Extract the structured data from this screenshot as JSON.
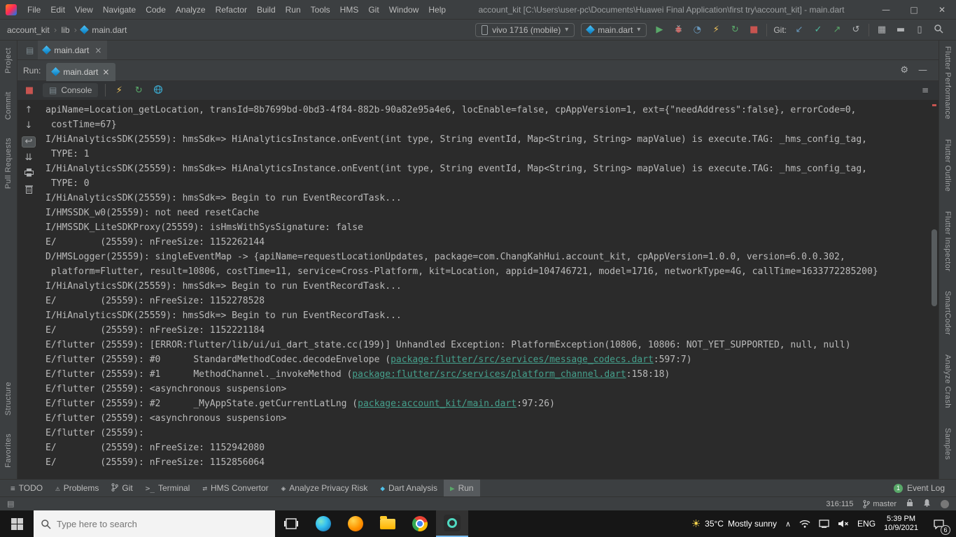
{
  "title_bar": {
    "menus": [
      "File",
      "Edit",
      "View",
      "Navigate",
      "Code",
      "Analyze",
      "Refactor",
      "Build",
      "Run",
      "Tools",
      "HMS",
      "Git",
      "Window",
      "Help"
    ],
    "title": "account_kit [C:\\Users\\user-pc\\Documents\\Huawei Final Application\\first try\\account_kit] - main.dart",
    "controls": {
      "minimize": "—",
      "maximize": "□",
      "close": "✕"
    }
  },
  "toolbar": {
    "breadcrumb": {
      "project": "account_kit",
      "dir": "lib",
      "file": "main.dart"
    },
    "device_selector": "vivo 1716 (mobile)",
    "run_config": "main.dart",
    "git_label": "Git:"
  },
  "editor": {
    "tab": "main.dart"
  },
  "run_panel": {
    "label": "Run:",
    "tab": "main.dart",
    "console_tab": "Console"
  },
  "left_stripe": {
    "top": [
      "Project",
      "Commit",
      "Pull Requests"
    ],
    "bottom": [
      "Structure",
      "Favorites"
    ]
  },
  "right_stripe": {
    "items": [
      "Flutter Performance",
      "Flutter Outline",
      "Flutter Inspector",
      "SmartCoder",
      "Analyze Crash",
      "Samples"
    ]
  },
  "console": {
    "lines": [
      [
        {
          "t": "apiName=Location_getLocation, transId=8b7699bd-0bd3-4f84-882b-90a82e95a4e6, locEnable=false, cpAppVersion=1, ext={\"needAddress\":false}, errorCode=0,"
        }
      ],
      [
        {
          "t": " costTime=67}"
        }
      ],
      [
        {
          "t": "I/HiAnalyticsSDK(25559): hmsSdk=> HiAnalyticsInstance.onEvent(int type, String eventId, Map<String, String> mapValue) is execute.TAG: _hms_config_tag,"
        }
      ],
      [
        {
          "t": " TYPE: 1"
        }
      ],
      [
        {
          "t": "I/HiAnalyticsSDK(25559): hmsSdk=> HiAnalyticsInstance.onEvent(int type, String eventId, Map<String, String> mapValue) is execute.TAG: _hms_config_tag,"
        }
      ],
      [
        {
          "t": " TYPE: 0"
        }
      ],
      [
        {
          "t": "I/HiAnalyticsSDK(25559): hmsSdk=> Begin to run EventRecordTask..."
        }
      ],
      [
        {
          "t": "I/HMSSDK_w0(25559): not need resetCache"
        }
      ],
      [
        {
          "t": "I/HMSSDK_LiteSDKProxy(25559): isHmsWithSysSignature: false"
        }
      ],
      [
        {
          "t": "E/        (25559): nFreeSize: 1152262144"
        }
      ],
      [
        {
          "t": "D/HMSLogger(25559): singleEventMap -> {apiName=requestLocationUpdates, package=com.ChangKahHui.account_kit, cpAppVersion=1.0.0, version=6.0.0.302,"
        }
      ],
      [
        {
          "t": " platform=Flutter, result=10806, costTime=11, service=Cross-Platform, kit=Location, appid=104746721, model=1716, networkType=4G, callTime=1633772285200}"
        }
      ],
      [
        {
          "t": "I/HiAnalyticsSDK(25559): hmsSdk=> Begin to run EventRecordTask..."
        }
      ],
      [
        {
          "t": "E/        (25559): nFreeSize: 1152278528"
        }
      ],
      [
        {
          "t": "I/HiAnalyticsSDK(25559): hmsSdk=> Begin to run EventRecordTask..."
        }
      ],
      [
        {
          "t": "E/        (25559): nFreeSize: 1152221184"
        }
      ],
      [
        {
          "t": "E/flutter (25559): [ERROR:flutter/lib/ui/ui_dart_state.cc(199)] Unhandled Exception: PlatformException(10806, 10806: NOT_YET_SUPPORTED, null, null)"
        }
      ],
      [
        {
          "t": "E/flutter (25559): #0      StandardMethodCodec.decodeEnvelope ("
        },
        {
          "t": "package:flutter/src/services/message_codecs.dart",
          "link": true
        },
        {
          "t": ":597:7)"
        }
      ],
      [
        {
          "t": "E/flutter (25559): #1      MethodChannel._invokeMethod ("
        },
        {
          "t": "package:flutter/src/services/platform_channel.dart",
          "link": true
        },
        {
          "t": ":158:18)"
        }
      ],
      [
        {
          "t": "E/flutter (25559): <asynchronous suspension>"
        }
      ],
      [
        {
          "t": "E/flutter (25559): #2      _MyAppState.getCurrentLatLng ("
        },
        {
          "t": "package:account_kit/main.dart",
          "link": true
        },
        {
          "t": ":97:26)"
        }
      ],
      [
        {
          "t": "E/flutter (25559): <asynchronous suspension>"
        }
      ],
      [
        {
          "t": "E/flutter (25559):"
        }
      ],
      [
        {
          "t": "E/        (25559): nFreeSize: 1152942080"
        }
      ],
      [
        {
          "t": "E/        (25559): nFreeSize: 1152856064"
        }
      ]
    ]
  },
  "tool_buttons": [
    {
      "label": "TODO",
      "icon": "≡"
    },
    {
      "label": "Problems",
      "icon": "⚠"
    },
    {
      "label": "Git",
      "icon": "svg:branch"
    },
    {
      "label": "Terminal",
      "icon": ">_"
    },
    {
      "label": "HMS Convertor",
      "icon": "⇄"
    },
    {
      "label": "Analyze Privacy Risk",
      "icon": "◈"
    },
    {
      "label": "Dart Analysis",
      "icon": "◆",
      "icon_color": "#4fc1e9"
    },
    {
      "label": "Run",
      "icon": "▶",
      "icon_color": "#59a869",
      "active": true
    }
  ],
  "event_log": {
    "label": "Event Log",
    "badge": "1"
  },
  "status_bar": {
    "position": "316:115",
    "branch": "master"
  },
  "taskbar": {
    "search_placeholder": "Type here to search",
    "weather_temp": "35°C",
    "weather_desc": "Mostly sunny",
    "language": "ENG",
    "time": "5:39 PM",
    "date": "10/9/2021",
    "notification_badge": "6"
  },
  "icons": {
    "run": "▶",
    "profiler": "◔",
    "hot_reload": "⚡",
    "hot_restart": "↻",
    "stop": "■",
    "git_update": "↙",
    "git_commit": "✓",
    "git_push": "↗",
    "git_rollback": "↺",
    "project_structure": "▦",
    "running_devices": "▬",
    "device_manager": "▯",
    "dropdown": "▾",
    "breadcrumb_sep": "›",
    "tab_close": "×",
    "scroll_up": "↑",
    "scroll_down": "↓",
    "soft_wrap": "↩",
    "scroll_end": "⇊",
    "console_tab": "▤",
    "editor_group": "▤",
    "options_menu": "≡",
    "gear": "⚙",
    "hide": "—",
    "chevron_up": "∧",
    "sun": "☀",
    "tool_switcher": "▤"
  },
  "colors": {
    "link_teal": "#45a08c",
    "error_red": "#c75450",
    "run_green": "#59a869",
    "bolt_yellow": "#f2c55c",
    "devtools_blue": "#3ba3c6",
    "panel_gray": "#3c3f41",
    "console_bg": "#2b2b2b"
  }
}
